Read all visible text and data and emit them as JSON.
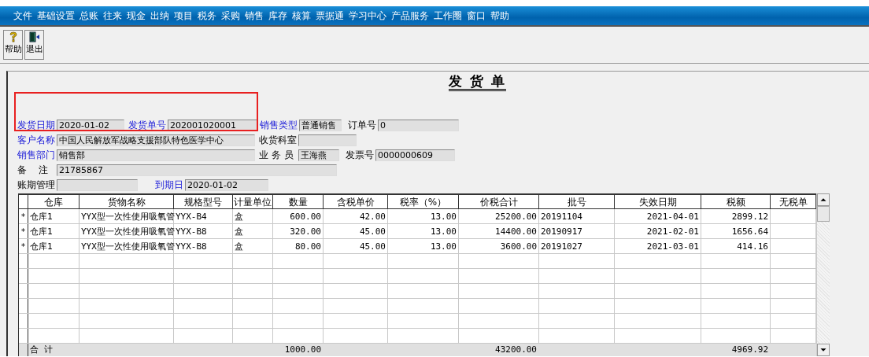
{
  "menu": [
    "文件",
    "基础设置",
    "总账",
    "往来",
    "现金",
    "出纳",
    "项目",
    "税务",
    "采购",
    "销售",
    "库存",
    "核算",
    "票据通",
    "学习中心",
    "产品服务",
    "工作圈",
    "窗口",
    "帮助"
  ],
  "toolbar": [
    {
      "label": "帮助",
      "kind": "help"
    },
    {
      "label": "退出",
      "kind": "exit"
    }
  ],
  "document": {
    "title": "发 货 单",
    "form_rows": [
      [
        {
          "label": "发货日期",
          "kind": "link",
          "value": "2020-01-02"
        },
        {
          "label": "发货单号",
          "kind": "link",
          "value": "202001020001"
        },
        {
          "label": "销售类型",
          "kind": "link",
          "value": "普通销售"
        },
        {
          "label": "订单号",
          "kind": "plain",
          "value": "0"
        }
      ],
      [
        {
          "label": "客户名称",
          "kind": "link",
          "value": "中国人民解放军战略支援部队特色医学中心"
        },
        {
          "label": "收货科室",
          "kind": "plain"
        }
      ],
      [
        {
          "label": "销售部门",
          "kind": "link",
          "value": "销售部"
        },
        {
          "label": "业 务 员",
          "kind": "plain",
          "value": "王海燕"
        },
        {
          "label": "发票号",
          "kind": "plain",
          "value": "0000000609"
        }
      ],
      [
        {
          "label": "备    注",
          "kind": "plain",
          "value": "21785867"
        }
      ],
      [
        {
          "label": "账期管理",
          "kind": "plain"
        },
        {
          "label": "到期日",
          "kind": "link",
          "value": "2020-01-02"
        }
      ]
    ],
    "table": {
      "columns": [
        "仓库",
        "货物名称",
        "规格型号",
        "计量单位",
        "数量",
        "含税单价",
        "税率（%）",
        "价税合计",
        "批号",
        "失效日期",
        "税额",
        "无税单"
      ],
      "rows": [
        {
          "marker": "*",
          "cells": [
            "仓库1",
            "YYX型一次性使用吸氧管",
            "YYX-B4",
            "盒",
            "600.00",
            "42.00",
            "13.00",
            "25200.00",
            "20191104",
            "2021-04-01",
            "2899.12",
            ""
          ]
        },
        {
          "marker": "*",
          "cells": [
            "仓库1",
            "YYX型一次性使用吸氧管",
            "YYX-B8",
            "盒",
            "320.00",
            "45.00",
            "13.00",
            "14400.00",
            "20190917",
            "2021-02-01",
            "1656.64",
            ""
          ]
        },
        {
          "marker": "*",
          "cells": [
            "仓库1",
            "YYX型一次性使用吸氧管",
            "YYX-B8",
            "盒",
            "80.00",
            "45.00",
            "13.00",
            "3600.00",
            "20191027",
            "2021-03-01",
            "414.16",
            ""
          ]
        }
      ],
      "total": {
        "label": "合  计",
        "cells": [
          "",
          "",
          "",
          "",
          "1000.00",
          "",
          "",
          "43200.00",
          "",
          "",
          "4969.92",
          ""
        ]
      }
    }
  }
}
